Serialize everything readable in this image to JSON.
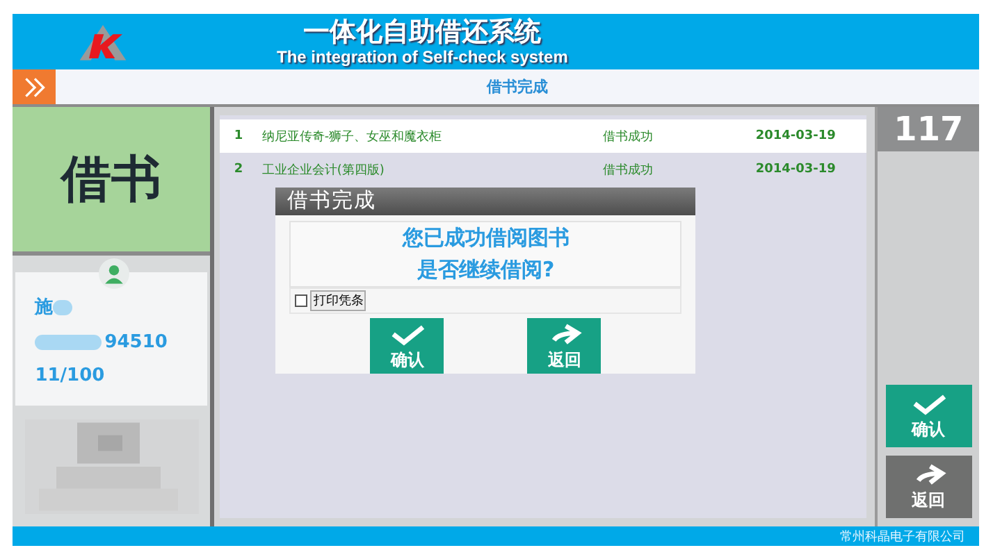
{
  "header": {
    "title": "一体化自助借还系统",
    "subtitle": "The integration of Self-check system"
  },
  "page_title": "借书完成",
  "mode_label": "借书",
  "reader": {
    "name": "施",
    "card": "94510",
    "count": "11/100"
  },
  "counter": "117",
  "records": [
    {
      "index": "1",
      "title": "纳尼亚传奇-狮子、女巫和魔衣柜",
      "status": "借书成功",
      "date": "2014-03-19"
    },
    {
      "index": "2",
      "title": "工业企业会计(第四版)",
      "status": "借书成功",
      "date": "2014-03-19"
    }
  ],
  "dialog": {
    "title": "借书完成",
    "message": [
      "您已成功借阅图书",
      "是否继续借阅?"
    ],
    "print_receipt": {
      "label": "打印凭条",
      "checked": false
    },
    "buttons": [
      {
        "label": "确认",
        "kind": "confirm"
      },
      {
        "label": "返回",
        "kind": "back"
      }
    ]
  },
  "side_buttons": [
    {
      "label": "确认",
      "kind": "confirm"
    },
    {
      "label": "返回",
      "kind": "back"
    }
  ],
  "footer": "常州科晶电子有限公司"
}
